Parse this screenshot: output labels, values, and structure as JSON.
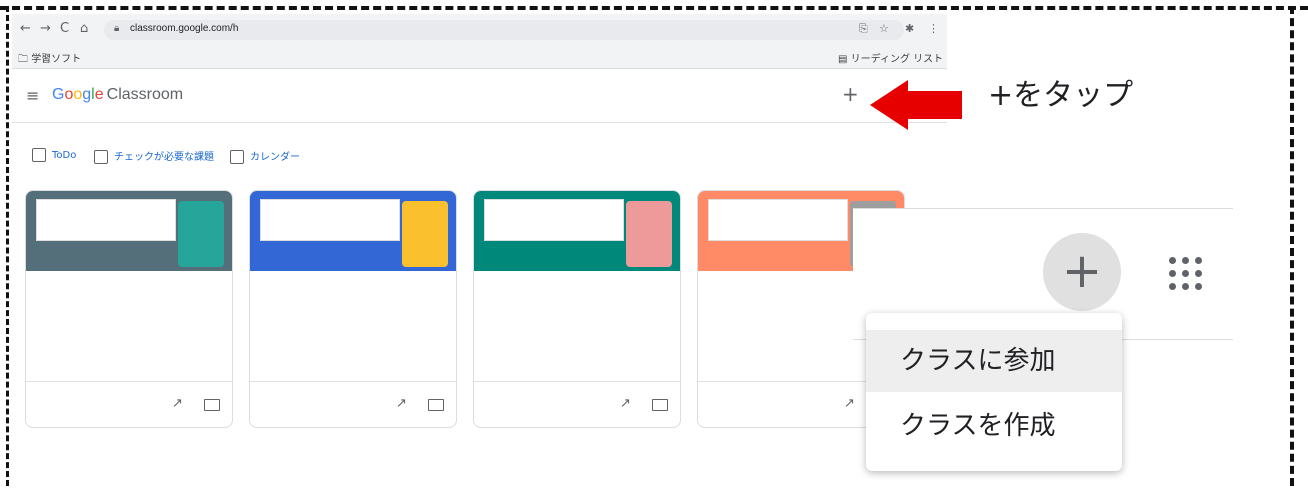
{
  "browser": {
    "url": "classroom.google.com/h",
    "bookmark_folder": "学習ソフト",
    "reading_list": "リーディング リスト"
  },
  "classroom": {
    "logo_google": [
      "G",
      "o",
      "o",
      "g",
      "l",
      "e"
    ],
    "logo_product": "Classroom",
    "header_add_glyph": "+"
  },
  "subnav": {
    "todo": "ToDo",
    "to_review": "チェックが必要な課題",
    "calendar": "カレンダー"
  },
  "cards": [
    {
      "banner_color": "#546e7a",
      "art_color": "#26a69a"
    },
    {
      "banner_color": "#3367d6",
      "art_color": "#fbc02d"
    },
    {
      "banner_color": "#00897b",
      "art_color": "#ef9a9a"
    },
    {
      "banner_color": "#ff8a65",
      "art_color": "#9e9e9e"
    }
  ],
  "zoom": {
    "add_glyph": "+",
    "menu": [
      "クラスに参加",
      "クラスを作成"
    ]
  },
  "annotation": {
    "instruction": "+をタップ",
    "arrow_color": "#e60000"
  }
}
